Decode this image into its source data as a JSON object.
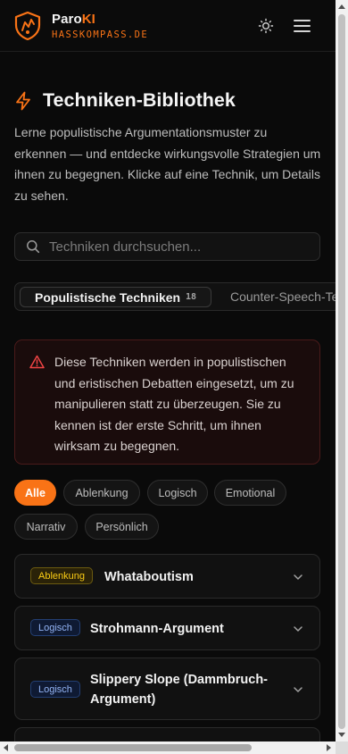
{
  "header": {
    "brand_prefix": "Paro",
    "brand_suffix": "KI",
    "domain": "HASSKOMPASS.DE",
    "icons": [
      "logo-icon",
      "sun-icon",
      "menu-icon"
    ]
  },
  "page": {
    "title": "Techniken-Bibliothek",
    "title_icon": "lightning-icon",
    "intro": "Lerne populistische Argumentationsmuster zu erkennen — und entdecke wirkungsvolle Strategien um ihnen zu begegnen. Klicke auf eine Technik, um Details zu sehen."
  },
  "search": {
    "placeholder": "Techniken durchsuchen...",
    "value": ""
  },
  "tabs": [
    {
      "label": "Populistische Techniken",
      "count": "18",
      "active": true
    },
    {
      "label": "Counter-Speech-Techniken",
      "active": false
    }
  ],
  "alert": {
    "text": "Diese Techniken werden in populistischen und eristischen Debatten eingesetzt, um zu manipulieren statt zu überzeugen. Sie zu kennen ist der erste Schritt, um ihnen wirksam zu begegnen."
  },
  "filters": [
    {
      "label": "Alle",
      "active": true
    },
    {
      "label": "Ablenkung"
    },
    {
      "label": "Logisch"
    },
    {
      "label": "Emotional"
    },
    {
      "label": "Narrativ"
    },
    {
      "label": "Persönlich"
    }
  ],
  "techniques": [
    {
      "category": "Ablenkung",
      "title": "Whataboutism"
    },
    {
      "category": "Logisch",
      "title": "Strohmann-Argument"
    },
    {
      "category": "Logisch",
      "title": "Slippery Slope (Dammbruch-Argument)"
    }
  ],
  "colors": {
    "accent": "#f97316",
    "background": "#0a0a0a",
    "alert_border": "#4a1a1a",
    "badge_ablenkung": "#facc15",
    "badge_logisch": "#93b4f5"
  }
}
